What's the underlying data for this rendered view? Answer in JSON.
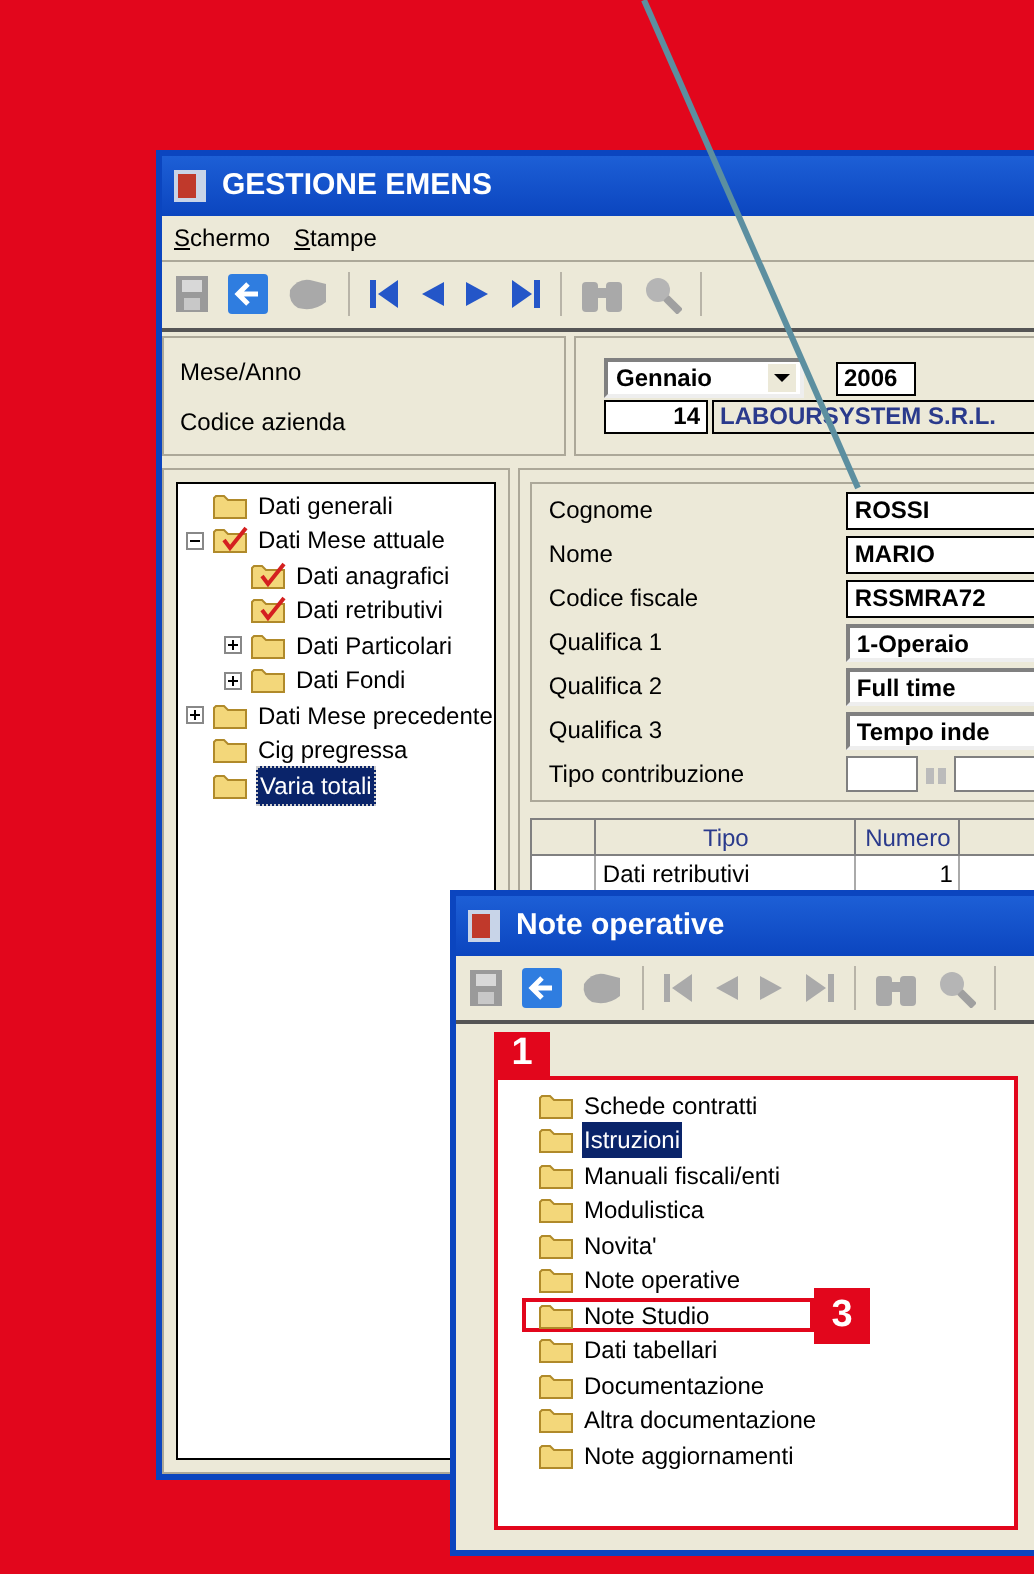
{
  "main_window": {
    "title": "GESTIONE EMENS",
    "menu": [
      "Schermo",
      "Stampe"
    ],
    "navigation_enabled": true,
    "header": {
      "labels": [
        "Mese/Anno",
        "Codice azienda"
      ],
      "month": "Gennaio",
      "year": "2006",
      "company_code": "14",
      "company_name": "LABOURSYSTEM S.R.L."
    },
    "tree": [
      {
        "label": "Dati generali",
        "kind": "folder",
        "selected": false
      },
      {
        "label": "Dati Mese attuale",
        "kind": "checked-folder",
        "selected": false,
        "expanded": true,
        "children": [
          {
            "label": "Dati anagrafici",
            "kind": "checked-folder",
            "selected": false
          },
          {
            "label": "Dati retributivi",
            "kind": "checked-folder",
            "selected": false
          },
          {
            "label": "Dati Particolari",
            "kind": "folder",
            "selected": false,
            "expanded": false
          },
          {
            "label": "Dati Fondi",
            "kind": "folder",
            "selected": false,
            "expanded": false
          }
        ]
      },
      {
        "label": "Dati Mese precedente",
        "kind": "folder",
        "selected": false,
        "expanded": false
      },
      {
        "label": "Cig pregressa",
        "kind": "folder",
        "selected": false
      },
      {
        "label": "Varia totali",
        "kind": "folder",
        "selected": true
      }
    ],
    "form": [
      {
        "label": "Cognome",
        "kind": "text",
        "value": "ROSSI"
      },
      {
        "label": "Nome",
        "kind": "text",
        "value": "MARIO"
      },
      {
        "label": "Codice fiscale",
        "kind": "text",
        "value": "RSSMRA72"
      },
      {
        "label": "Qualifica 1",
        "kind": "select",
        "value": "1-Operaio"
      },
      {
        "label": "Qualifica 2",
        "kind": "select",
        "value": "Full time"
      },
      {
        "label": "Qualifica 3",
        "kind": "select",
        "value": "Tempo inde"
      },
      {
        "label": "Tipo contribuzione",
        "kind": "lookup"
      }
    ],
    "table": {
      "columns": [
        "",
        "Tipo",
        "Numero"
      ],
      "rows": [
        [
          "",
          "Dati retributivi",
          "1"
        ]
      ]
    }
  },
  "notes_window": {
    "title": "Note operative",
    "navigation_enabled": false,
    "tree": [
      {
        "label": "Schede contratti",
        "selected": false,
        "highlighted": false
      },
      {
        "label": "Istruzioni",
        "selected": true,
        "highlighted": false
      },
      {
        "label": "Manuali fiscali/enti",
        "selected": false,
        "highlighted": false
      },
      {
        "label": "Modulistica",
        "selected": false,
        "highlighted": false
      },
      {
        "label": "Novita'",
        "selected": false,
        "highlighted": false
      },
      {
        "label": "Note operative",
        "selected": false,
        "highlighted": false
      },
      {
        "label": "Note Studio",
        "selected": false,
        "highlighted": true
      },
      {
        "label": "Dati tabellari",
        "selected": false,
        "highlighted": false
      },
      {
        "label": "Documentazione",
        "selected": false,
        "highlighted": false
      },
      {
        "label": "Altra documentazione",
        "selected": false,
        "highlighted": false
      },
      {
        "label": "Note aggiornamenti",
        "selected": false,
        "highlighted": false
      }
    ],
    "callouts": [
      "1",
      "3"
    ]
  }
}
